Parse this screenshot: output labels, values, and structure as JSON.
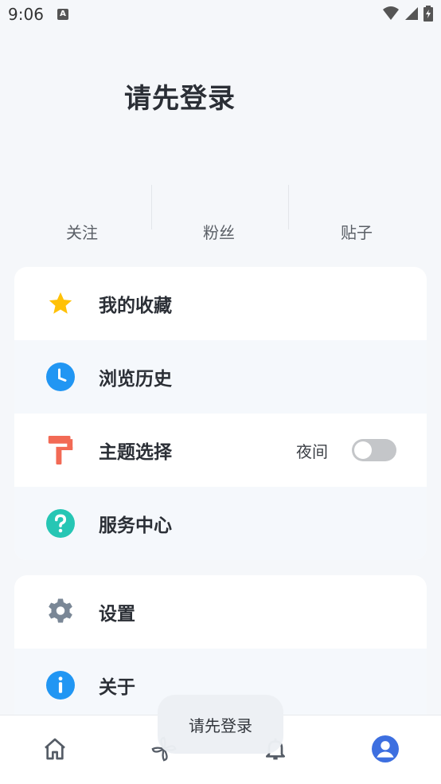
{
  "status_bar": {
    "time": "9:06",
    "notification_icon": "A"
  },
  "header": {
    "title": "请先登录"
  },
  "stats": [
    {
      "label": "关注"
    },
    {
      "label": "粉丝"
    },
    {
      "label": "贴子"
    }
  ],
  "menu_card_1": [
    {
      "label": "我的收藏",
      "icon": "star-icon",
      "color": "#FFC107"
    },
    {
      "label": "浏览历史",
      "icon": "clock-icon",
      "color": "#2196F3"
    },
    {
      "label": "主题选择",
      "icon": "paint-roller-icon",
      "color": "#F26A55",
      "extra": "夜间",
      "toggle_on": false
    },
    {
      "label": "服务中心",
      "icon": "question-icon",
      "color": "#26C6B4"
    }
  ],
  "menu_card_2": [
    {
      "label": "设置",
      "icon": "gear-icon",
      "color": "#7A8796"
    },
    {
      "label": "关于",
      "icon": "info-icon",
      "color": "#2196F3"
    }
  ],
  "bottom_nav": [
    {
      "name": "home",
      "icon": "home-icon",
      "active": false
    },
    {
      "name": "discover",
      "icon": "pinwheel-icon",
      "active": false
    },
    {
      "name": "notifications",
      "icon": "bell-icon",
      "active": false
    },
    {
      "name": "profile",
      "icon": "user-icon",
      "active": true,
      "color": "#3D6FE0"
    }
  ],
  "toast": {
    "text": "请先登录"
  }
}
